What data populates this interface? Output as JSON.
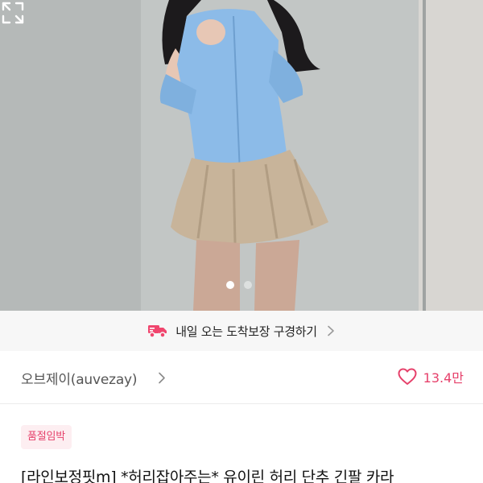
{
  "product": {
    "image_count": 2,
    "active_image_index": 0
  },
  "delivery_banner": {
    "text": "내일 오는 도착보장 구경하기",
    "icon": "truck-icon",
    "icon_color": "#f0466e"
  },
  "shop": {
    "name": "오브제이(auvezay)",
    "likes": "13.4만",
    "like_icon": "heart-outline-icon",
    "accent_color": "#e6416b"
  },
  "status_badge": {
    "label": "품절임박"
  },
  "title": "[라인보정핏m] *허리잡아주는* 유이린 허리 단추 긴팔 카라"
}
